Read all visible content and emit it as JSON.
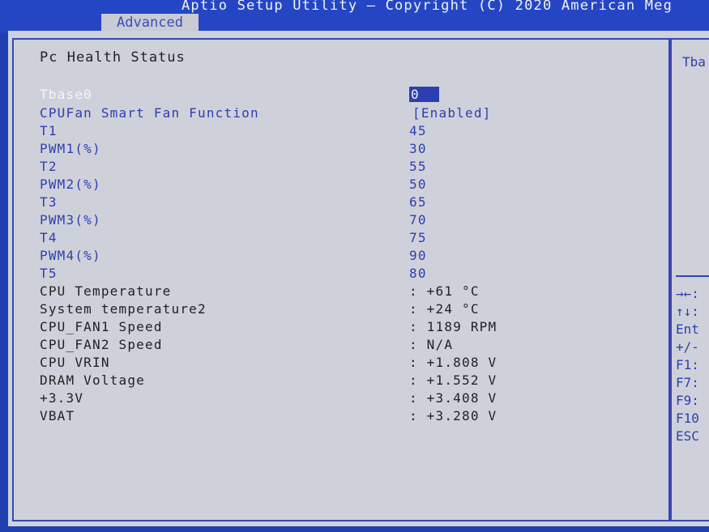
{
  "header": {
    "title": "Aptio Setup Utility – Copyright (C) 2020 American Meg",
    "tab": "Advanced"
  },
  "page": {
    "section_title": "Pc Health Status"
  },
  "settings": [
    {
      "label": "Tbase0",
      "value": "0"
    },
    {
      "label": "CPUFan Smart Fan Function",
      "value": "[Enabled]"
    },
    {
      "label": "T1",
      "value": "45"
    },
    {
      "label": "PWM1(%)",
      "value": "30"
    },
    {
      "label": "T2",
      "value": "55"
    },
    {
      "label": "PWM2(%)",
      "value": "50"
    },
    {
      "label": "T3",
      "value": "65"
    },
    {
      "label": "PWM3(%)",
      "value": "70"
    },
    {
      "label": "T4",
      "value": "75"
    },
    {
      "label": "PWM4(%)",
      "value": "90"
    },
    {
      "label": "T5",
      "value": "80"
    }
  ],
  "readings": [
    {
      "label": "CPU Temperature",
      "value": ": +61 °C"
    },
    {
      "label": "System temperature2",
      "value": ": +24 °C"
    },
    {
      "label": "CPU_FAN1 Speed",
      "value": ": 1189 RPM"
    },
    {
      "label": "CPU_FAN2 Speed",
      "value": ": N/A"
    },
    {
      "label": "CPU VRIN",
      "value": ": +1.808 V"
    },
    {
      "label": "DRAM Voltage",
      "value": ": +1.552 V"
    },
    {
      "label": "+3.3V",
      "value": ": +3.408 V"
    },
    {
      "label": "VBAT",
      "value": ": +3.280 V"
    }
  ],
  "help_panel": {
    "text": "Tba",
    "keys": [
      "→←:",
      "↑↓:",
      "Ent",
      "+/-",
      "F1:",
      "F7:",
      "F9:",
      "F10",
      "ESC"
    ]
  },
  "colors": {
    "bios_blue": "#2546c4",
    "panel_gray": "#cfd1da",
    "option_blue": "#2c3fb0"
  }
}
